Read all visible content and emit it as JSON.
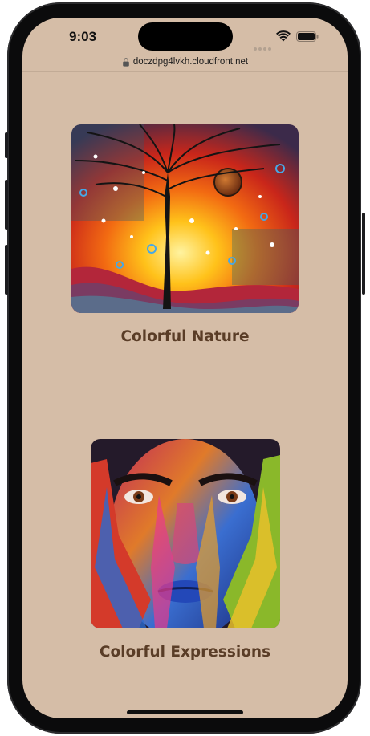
{
  "status_bar": {
    "time": "9:03",
    "icons": [
      "signal-dots-icon",
      "wifi-icon",
      "battery-icon"
    ]
  },
  "browser": {
    "url": "doczdpg4lvkh.cloudfront.net",
    "secure_icon": "lock-icon"
  },
  "gallery": {
    "items": [
      {
        "caption": "Colorful Nature",
        "image": "tree-night-painting"
      },
      {
        "caption": "Colorful Expressions",
        "image": "painted-face-photo"
      }
    ]
  },
  "colors": {
    "page_background": "#d5bda7",
    "caption_text": "#5a3d27"
  }
}
